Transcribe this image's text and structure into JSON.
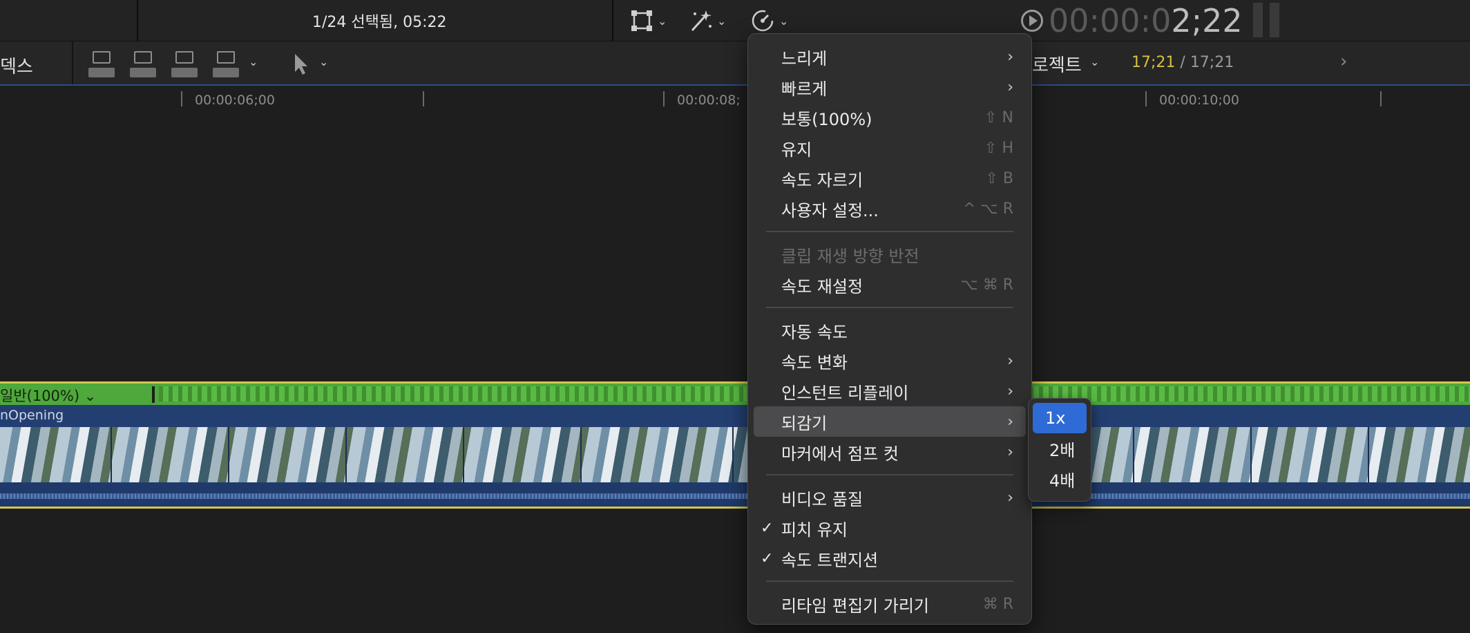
{
  "topbar": {
    "selection_info": "1/24 선택됨, 05:22",
    "timecode_dim": "00:00:0",
    "timecode_bright": "2;22"
  },
  "secbar": {
    "index_label": "덱스",
    "project_label": "로젝트",
    "project_time_current": "17;21",
    "project_time_sep": " / ",
    "project_time_total": "17;21"
  },
  "ruler": {
    "labels": [
      "00:00:06;00",
      "00:00:08;",
      "00:00:10;00"
    ]
  },
  "clip": {
    "speed_label": "일반(100%)",
    "name": "nOpening"
  },
  "menu": {
    "items": [
      {
        "label": "느리게",
        "submenu": true
      },
      {
        "label": "빠르게",
        "submenu": true
      },
      {
        "label": "보통(100%)",
        "shortcut": "⇧ N"
      },
      {
        "label": "유지",
        "shortcut": "⇧ H"
      },
      {
        "label": "속도 자르기",
        "shortcut": "⇧ B"
      },
      {
        "label": "사용자 설정...",
        "shortcut": "^ ⌥ R"
      },
      {
        "label": "클립 재생 방향 반전",
        "disabled": true
      },
      {
        "label": "속도 재설정",
        "shortcut": "⌥ ⌘ R"
      },
      {
        "label": "자동 속도"
      },
      {
        "label": "속도 변화",
        "submenu": true
      },
      {
        "label": "인스턴트 리플레이",
        "submenu": true
      },
      {
        "label": "되감기",
        "submenu": true,
        "highlighted": true
      },
      {
        "label": "마커에서 점프 컷",
        "submenu": true
      },
      {
        "label": "비디오 품질",
        "submenu": true
      },
      {
        "label": "피치 유지",
        "checked": true
      },
      {
        "label": "속도 트랜지션",
        "checked": true
      },
      {
        "label": "리타임 편집기 가리기",
        "shortcut": "⌘ R"
      }
    ]
  },
  "submenu": {
    "items": [
      "1x",
      "2배",
      "4배"
    ],
    "selected": "1x"
  },
  "colors": {
    "accent_blue": "#2f6bd6",
    "speed_green": "#4ea83b",
    "clip_blue": "#233f72",
    "timecode_yellow": "#d9c13a"
  }
}
